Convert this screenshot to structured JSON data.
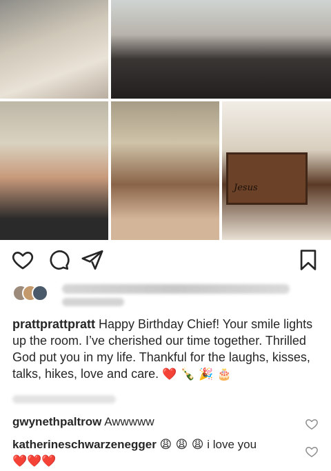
{
  "post": {
    "photos": [
      {
        "name": "photo-1"
      },
      {
        "name": "photo-2"
      },
      {
        "name": "photo-3"
      },
      {
        "name": "photo-4",
        "sign_text": "Jesus"
      },
      {
        "name": "photo-5"
      }
    ],
    "icons": {
      "like": "heart-icon",
      "comment": "comment-icon",
      "share": "send-icon",
      "save": "bookmark-icon"
    },
    "caption": {
      "username": "prattprattpratt",
      "text": "Happy Birthday Chief! Your smile lights up the room. I’ve cherished our time together. Thrilled God put you in my life. Thankful for the laughs, kisses, talks, hikes, love and care.",
      "emojis": "❤️ 🍾 🎉 🎂"
    }
  },
  "comments": [
    {
      "username": "gwynethpaltrow",
      "text": "Awwwww"
    },
    {
      "username": "katherineschwarzenegger",
      "emojis_before": "😩 😩 😩",
      "text": "i love you",
      "emojis_after": "❤️❤️❤️"
    }
  ],
  "colors": {
    "text": "#262626",
    "heart_red": "#d4202c",
    "icon": "#262626"
  }
}
